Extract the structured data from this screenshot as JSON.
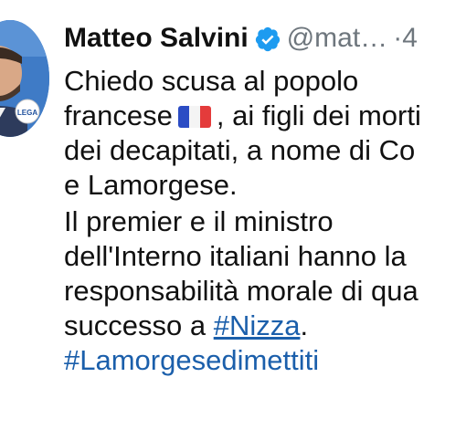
{
  "tweet": {
    "author": {
      "display_name": "Matteo Salvini",
      "handle": "@mat…",
      "separator": "·",
      "time": "4",
      "verified_icon": "verified-badge-icon",
      "avatar_badge_text": "LEGA"
    },
    "body": {
      "line1": "Chiedo scusa al popolo",
      "line2_before": "francese",
      "flag_icon": "france-flag-icon",
      "flag_colors": [
        "#2b4cc4",
        "#f4f4f4",
        "#e43b3b"
      ],
      "line2_after": ", ai figli dei morti",
      "line3": "dei decapitati, a nome di Co",
      "line4": "e Lamorgese.",
      "line5": "Il premier e il ministro",
      "line6": "dell'Interno italiani hanno la",
      "line7": "responsabilità morale di qua",
      "line8_before": "successo a ",
      "line8_link": "#Nizza",
      "line8_after": ".",
      "line9_hashtag": "#Lamorgesedimettiti"
    },
    "colors": {
      "link": "#1b5fab",
      "verified": "#1d9bf0",
      "muted": "#6e767d"
    }
  }
}
